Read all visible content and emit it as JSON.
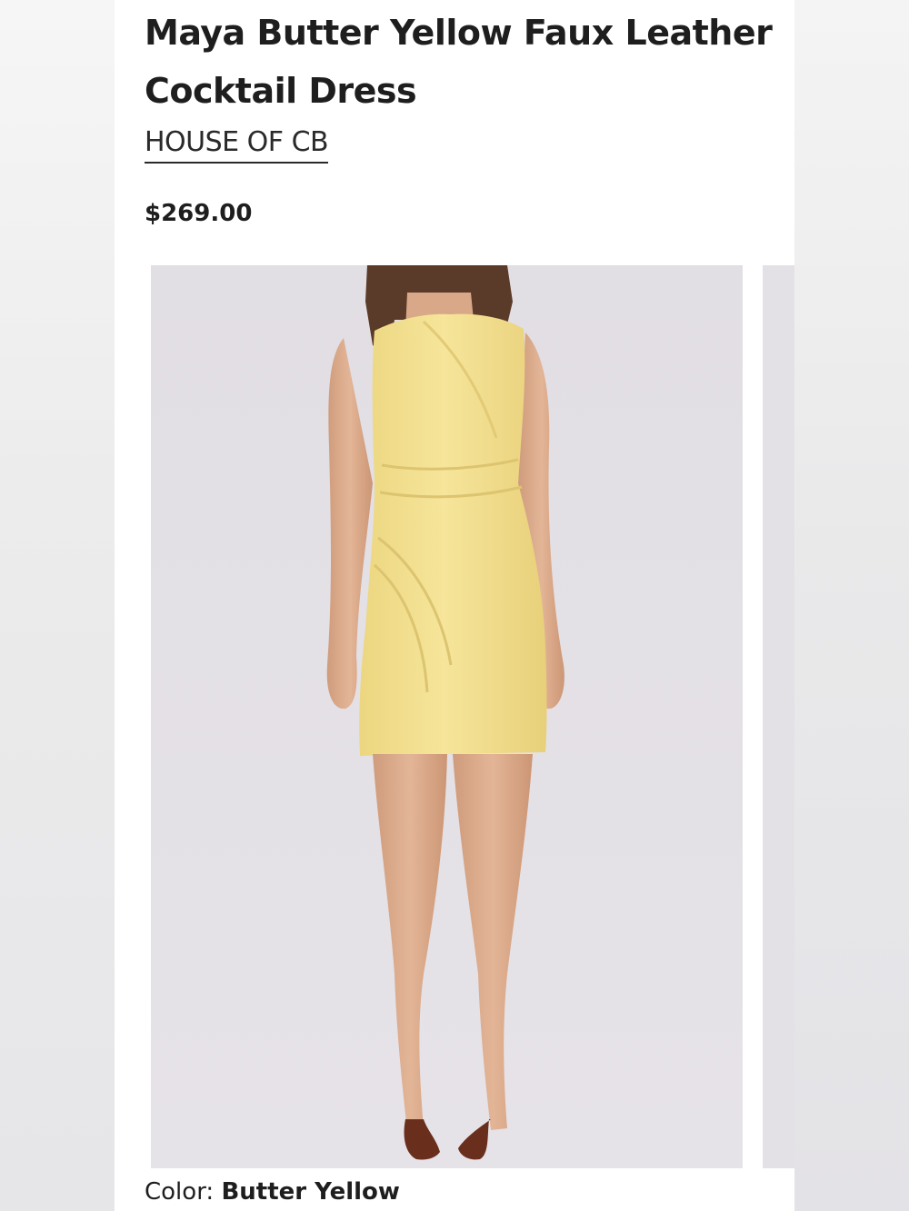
{
  "product": {
    "title": "Maya Butter Yellow Faux Leather Cocktail Dress",
    "brand": "HOUSE OF CB",
    "price": "$269.00"
  },
  "selection": {
    "color_label": "Color: ",
    "color_value": "Butter Yellow"
  },
  "colors": {
    "page_background": "#ffffff",
    "image_background": "#e2dfe5",
    "dress": "#f3e08f",
    "text": "#1e1e1e"
  }
}
